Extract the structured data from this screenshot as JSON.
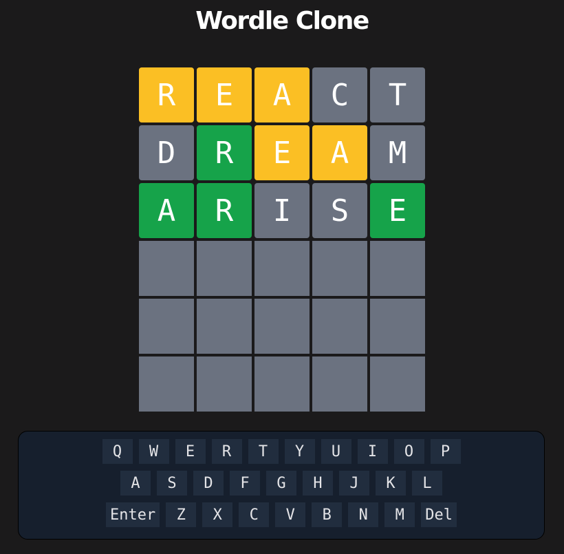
{
  "header": {
    "title": "Wordle Clone"
  },
  "colors": {
    "background": "#1b1a1b",
    "present": "#fbbf24",
    "correct": "#16a34a",
    "absent": "#6b7280",
    "keyboard_panel": "#161f2d",
    "key": "#212d3e"
  },
  "board": {
    "rows": [
      {
        "tiles": [
          {
            "letter": "R",
            "state": "present"
          },
          {
            "letter": "E",
            "state": "present"
          },
          {
            "letter": "A",
            "state": "present"
          },
          {
            "letter": "C",
            "state": "absent"
          },
          {
            "letter": "T",
            "state": "absent"
          }
        ]
      },
      {
        "tiles": [
          {
            "letter": "D",
            "state": "absent"
          },
          {
            "letter": "R",
            "state": "correct"
          },
          {
            "letter": "E",
            "state": "present"
          },
          {
            "letter": "A",
            "state": "present"
          },
          {
            "letter": "M",
            "state": "absent"
          }
        ]
      },
      {
        "tiles": [
          {
            "letter": "A",
            "state": "correct"
          },
          {
            "letter": "R",
            "state": "correct"
          },
          {
            "letter": "I",
            "state": "absent"
          },
          {
            "letter": "S",
            "state": "absent"
          },
          {
            "letter": "E",
            "state": "correct"
          }
        ]
      },
      {
        "tiles": [
          {
            "letter": "",
            "state": "empty"
          },
          {
            "letter": "",
            "state": "empty"
          },
          {
            "letter": "",
            "state": "empty"
          },
          {
            "letter": "",
            "state": "empty"
          },
          {
            "letter": "",
            "state": "empty"
          }
        ]
      },
      {
        "tiles": [
          {
            "letter": "",
            "state": "empty"
          },
          {
            "letter": "",
            "state": "empty"
          },
          {
            "letter": "",
            "state": "empty"
          },
          {
            "letter": "",
            "state": "empty"
          },
          {
            "letter": "",
            "state": "empty"
          }
        ]
      },
      {
        "tiles": [
          {
            "letter": "",
            "state": "empty"
          },
          {
            "letter": "",
            "state": "empty"
          },
          {
            "letter": "",
            "state": "empty"
          },
          {
            "letter": "",
            "state": "empty"
          },
          {
            "letter": "",
            "state": "empty"
          }
        ]
      }
    ]
  },
  "keyboard": {
    "rows": [
      {
        "keys": [
          "Q",
          "W",
          "E",
          "R",
          "T",
          "Y",
          "U",
          "I",
          "O",
          "P"
        ]
      },
      {
        "keys": [
          "A",
          "S",
          "D",
          "F",
          "G",
          "H",
          "J",
          "K",
          "L"
        ]
      },
      {
        "keys": [
          "Enter",
          "Z",
          "X",
          "C",
          "V",
          "B",
          "N",
          "M",
          "Del"
        ]
      }
    ]
  }
}
